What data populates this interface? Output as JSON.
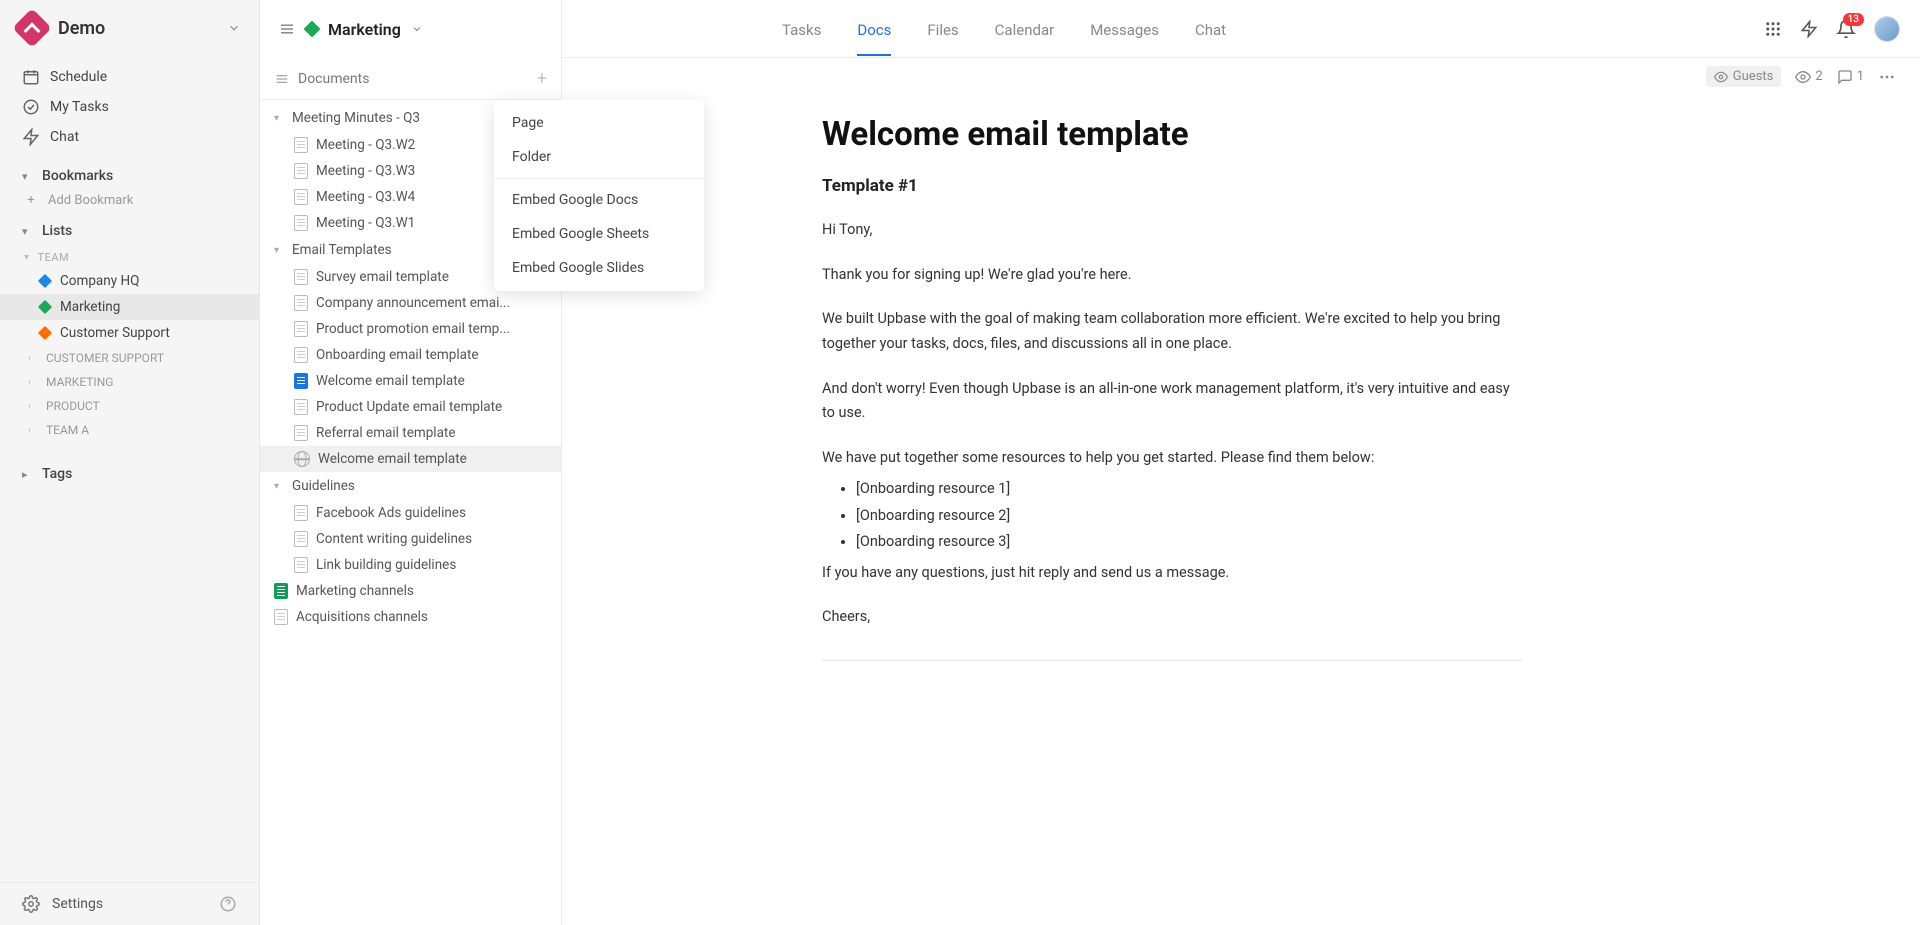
{
  "workspace": {
    "name": "Demo"
  },
  "leftNav": {
    "schedule": "Schedule",
    "myTasks": "My Tasks",
    "chat": "Chat",
    "bookmarks": "Bookmarks",
    "addBookmark": "Add Bookmark",
    "lists": "Lists",
    "teamGroup": "TEAM",
    "companyHQ": "Company HQ",
    "marketing": "Marketing",
    "customerSupport": "Customer Support",
    "folderCustomerSupport": "CUSTOMER SUPPORT",
    "folderMarketing": "MARKETING",
    "folderProduct": "PRODUCT",
    "folderTeamA": "TEAM A",
    "tags": "Tags",
    "settings": "Settings"
  },
  "docHeader": {
    "space": "Marketing",
    "sectionTitle": "Documents"
  },
  "docTree": {
    "folder1": "Meeting Minutes - Q3",
    "f1_i1": "Meeting - Q3.W2",
    "f1_i2": "Meeting - Q3.W3",
    "f1_i3": "Meeting - Q3.W4",
    "f1_i4": "Meeting - Q3.W1",
    "folder2": "Email Templates",
    "f2_i1": "Survey email template",
    "f2_i2": "Company announcement emai...",
    "f2_i3": "Product promotion email temp...",
    "f2_i4": "Onboarding email template",
    "f2_i5": "Welcome email template",
    "f2_i6": "Product Update email template",
    "f2_i7": "Referral email template",
    "f2_i8": "Welcome email template",
    "folder3": "Guidelines",
    "f3_i1": "Facebook Ads guidelines",
    "f3_i2": "Content writing guidelines",
    "f3_i3": "Link building guidelines",
    "root_i1": "Marketing channels",
    "root_i2": "Acquisitions channels"
  },
  "topTabs": {
    "tasks": "Tasks",
    "docs": "Docs",
    "files": "Files",
    "calendar": "Calendar",
    "messages": "Messages",
    "chat": "Chat"
  },
  "notifCount": "13",
  "metaBar": {
    "guests": "Guests",
    "views": "2",
    "comments": "1"
  },
  "dropdown": {
    "page": "Page",
    "folder": "Folder",
    "gdocs": "Embed Google Docs",
    "gsheets": "Embed Google Sheets",
    "gslides": "Embed Google Slides"
  },
  "document": {
    "title": "Welcome email template",
    "subtitle": "Template #1",
    "p1": "Hi Tony,",
    "p2": "Thank you for signing up! We're glad you're here.",
    "p3": "We built Upbase with the goal of making team collaboration more efficient. We're excited to help you bring together your tasks, docs, files, and discussions all in one place.",
    "p4": "And don't worry! Even though Upbase is an all-in-one work management platform, it's very intuitive and easy to use.",
    "p5": "We have put together some resources to help you get started. Please find them below:",
    "li1": "[Onboarding resource 1]",
    "li2": "[Onboarding resource 2]",
    "li3": "[Onboarding resource 3]",
    "p6": "If you have any questions, just hit reply and send us a message.",
    "p7": "Cheers,"
  }
}
